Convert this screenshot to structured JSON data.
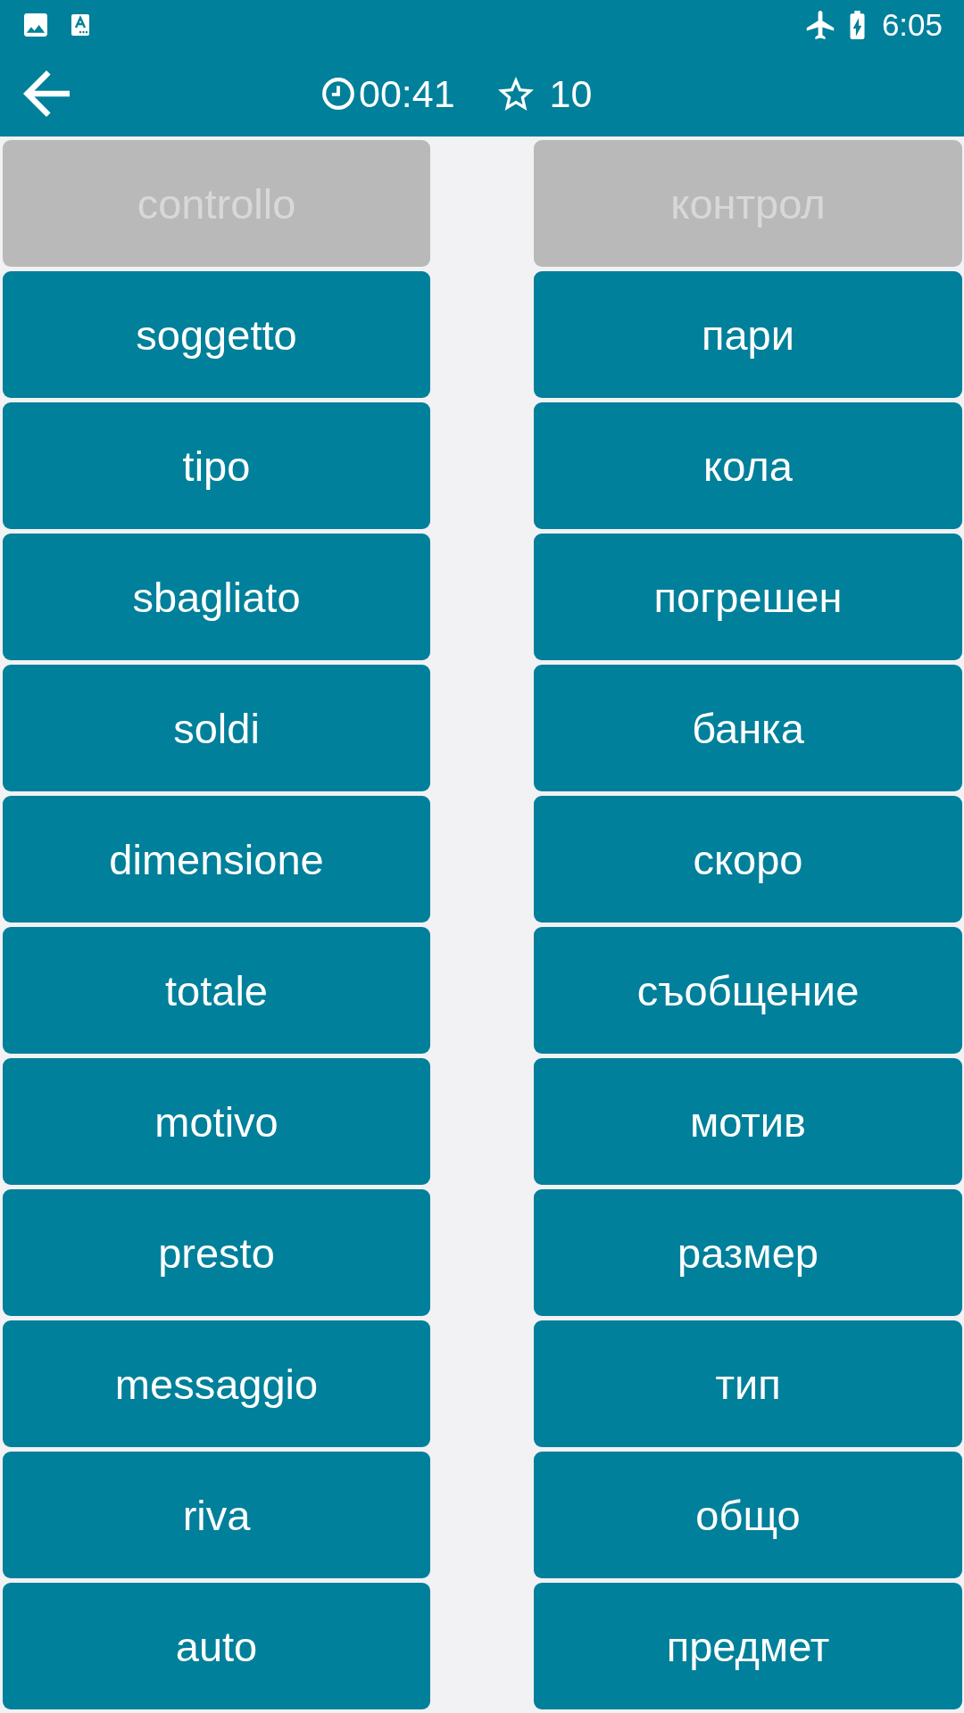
{
  "status_bar": {
    "time": "6:05"
  },
  "toolbar": {
    "timer": "00:41",
    "score": "10"
  },
  "left_words": [
    {
      "label": "controllo",
      "disabled": true
    },
    {
      "label": "soggetto",
      "disabled": false
    },
    {
      "label": "tipo",
      "disabled": false
    },
    {
      "label": "sbagliato",
      "disabled": false
    },
    {
      "label": "soldi",
      "disabled": false
    },
    {
      "label": "dimensione",
      "disabled": false
    },
    {
      "label": "totale",
      "disabled": false
    },
    {
      "label": "motivo",
      "disabled": false
    },
    {
      "label": "presto",
      "disabled": false
    },
    {
      "label": "messaggio",
      "disabled": false
    },
    {
      "label": "riva",
      "disabled": false
    },
    {
      "label": "auto",
      "disabled": false
    }
  ],
  "right_words": [
    {
      "label": "контрол",
      "disabled": true
    },
    {
      "label": "пари",
      "disabled": false
    },
    {
      "label": "кола",
      "disabled": false
    },
    {
      "label": "погрешен",
      "disabled": false
    },
    {
      "label": "банка",
      "disabled": false
    },
    {
      "label": "скоро",
      "disabled": false
    },
    {
      "label": "съобщение",
      "disabled": false
    },
    {
      "label": "мотив",
      "disabled": false
    },
    {
      "label": "размер",
      "disabled": false
    },
    {
      "label": "тип",
      "disabled": false
    },
    {
      "label": "общо",
      "disabled": false
    },
    {
      "label": "предмет",
      "disabled": false
    }
  ]
}
